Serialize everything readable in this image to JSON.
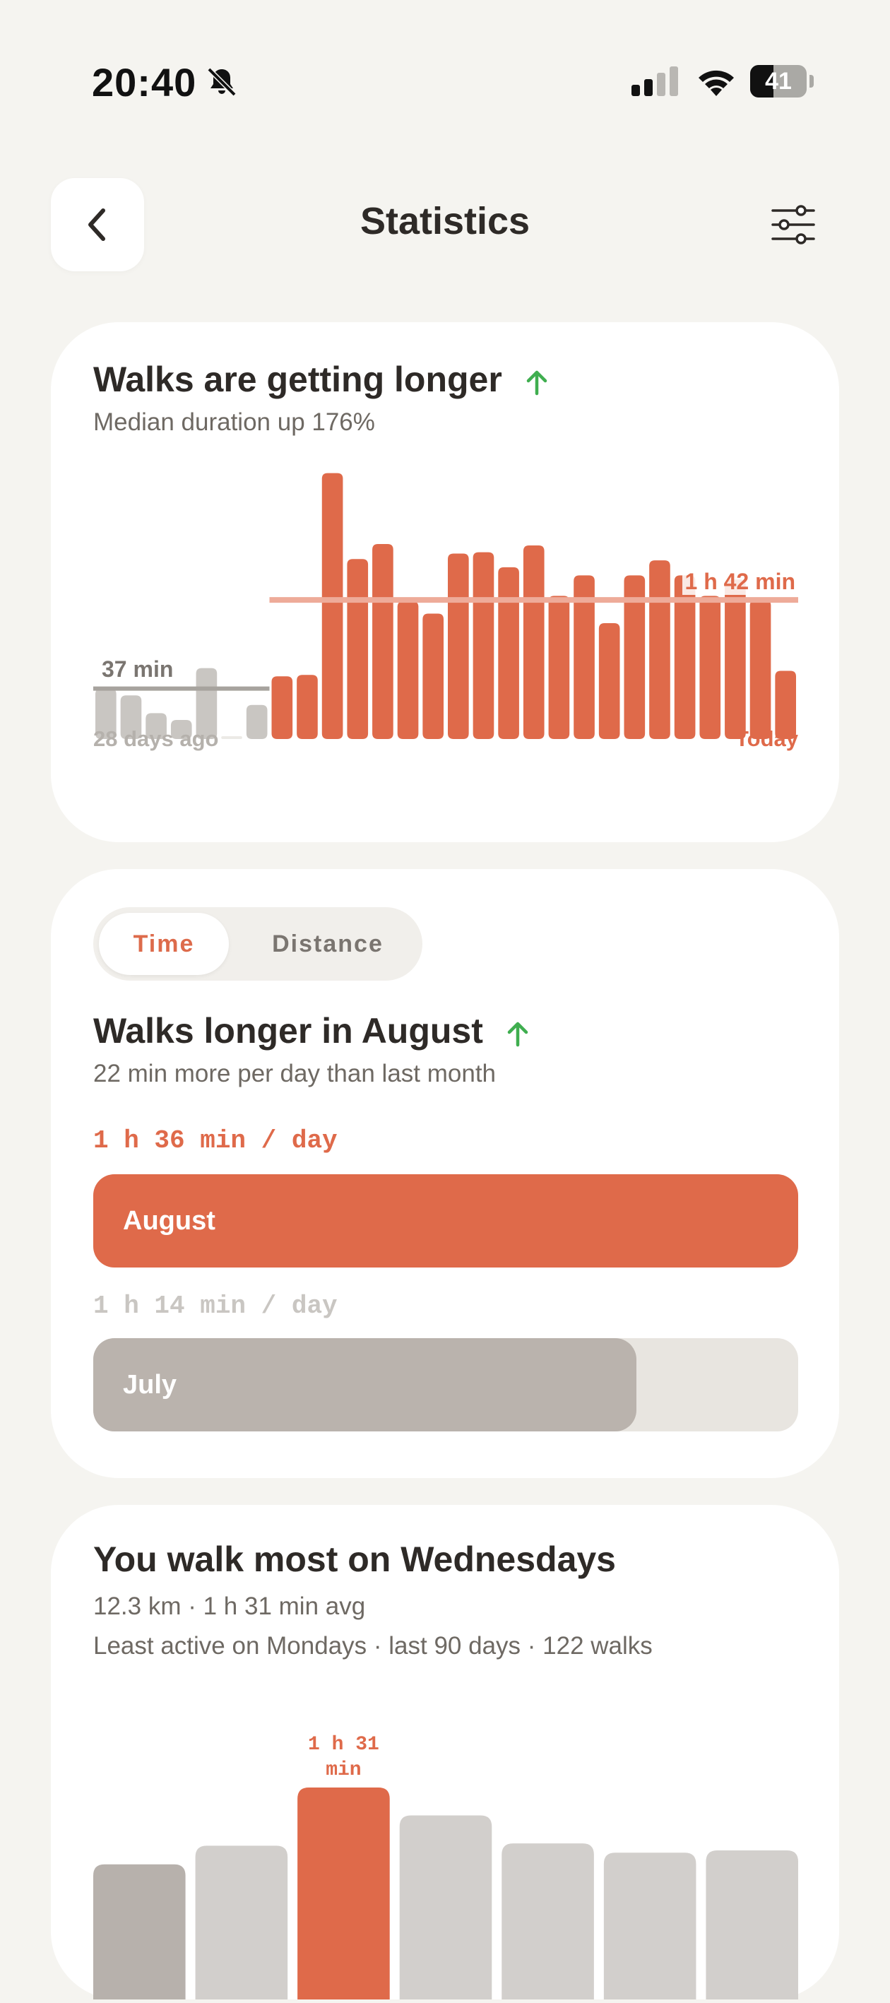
{
  "status_bar": {
    "time": "20:40",
    "battery": "41",
    "battery_level": 0.41,
    "silent_icon": "bell-slash-icon",
    "signal_icon": "cellular-signal-icon",
    "wifi_icon": "wifi-icon"
  },
  "header": {
    "title": "Statistics",
    "back_icon": "chevron-left-icon",
    "filter_icon": "sliders-icon"
  },
  "colors": {
    "accent": "#df6a4a",
    "accent_light": "#eeab99",
    "gray_bar": "#c9c6c2",
    "green": "#3fae4f"
  },
  "duration_card": {
    "title": "Walks are getting longer",
    "subtitle": "Median duration up 176%",
    "previous_median_label": "37 min",
    "current_median_label": "1 h 42 min",
    "start_label": "28 days ago",
    "end_label": "Today",
    "chart_data": {
      "type": "bar",
      "unit": "minutes per day",
      "previous_period_values": [
        37,
        32,
        19,
        14,
        52,
        2,
        25
      ],
      "current_period_values": [
        46,
        47,
        195,
        132,
        143,
        101,
        92,
        136,
        137,
        126,
        142,
        105,
        120,
        85,
        120,
        131,
        120,
        105,
        117,
        102,
        50
      ],
      "previous_median": 37,
      "current_median": 102,
      "ylim": [
        0,
        200
      ]
    }
  },
  "compare_card": {
    "tabs": [
      "Time",
      "Distance"
    ],
    "active_tab": "Time",
    "title": "Walks longer in August",
    "subtitle": "22 min more per day than last month",
    "current": {
      "label": "August",
      "value_text": "1 h 36 min / day",
      "minutes": 96
    },
    "previous": {
      "label": "July",
      "value_text": "1 h 14 min / day",
      "minutes": 74
    }
  },
  "weekday_card": {
    "title": "You walk most on Wednesdays",
    "line1": "12.3 km · 1 h 31 min avg",
    "line2": "Least active on Mondays · last 90 days · 122 walks",
    "peak_label": [
      "1 h 31",
      "min"
    ],
    "chart_data": {
      "type": "bar",
      "unit": "minutes",
      "values": [
        58,
        66,
        91,
        79,
        67,
        63,
        64
      ],
      "highlight_index": 2,
      "least_index": 0
    }
  }
}
